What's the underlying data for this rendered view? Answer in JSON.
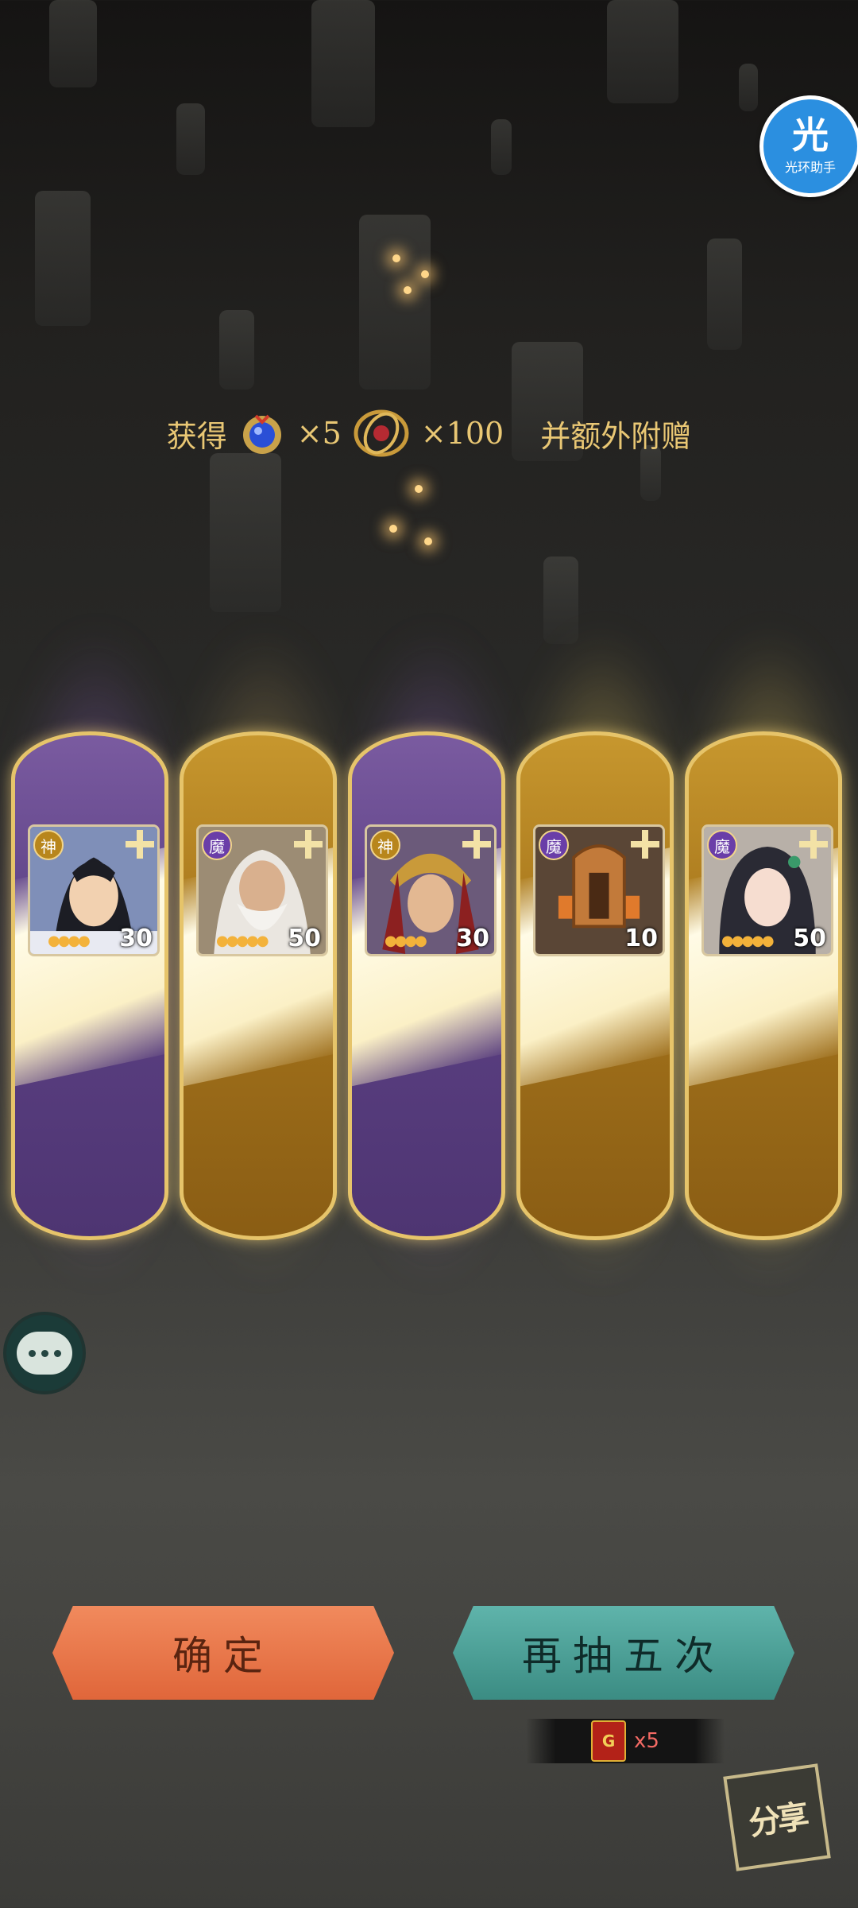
{
  "reward": {
    "prefix": "获得",
    "item1_count": "×5",
    "item2_count": "×100",
    "suffix": "并额外附赠",
    "item1_icon": "blue-gem-icon",
    "item2_icon": "red-orb-icon"
  },
  "assistant": {
    "glyph": "光",
    "label": "光环助手"
  },
  "cards": [
    {
      "badge": "神",
      "badge_type": "gold",
      "level": "30",
      "stars": 4,
      "frame": "purple"
    },
    {
      "badge": "魔",
      "badge_type": "purple",
      "level": "50",
      "stars": 5,
      "frame": "gold"
    },
    {
      "badge": "神",
      "badge_type": "gold",
      "level": "30",
      "stars": 4,
      "frame": "purple"
    },
    {
      "badge": "魔",
      "badge_type": "purple",
      "level": "10",
      "stars": 0,
      "frame": "gold"
    },
    {
      "badge": "魔",
      "badge_type": "purple",
      "level": "50",
      "stars": 5,
      "frame": "gold"
    }
  ],
  "buttons": {
    "confirm": "确定",
    "draw_again": "再抽五次"
  },
  "cost": {
    "count": "x5",
    "ticket_letter": "G"
  },
  "share": {
    "label": "分享"
  },
  "colors": {
    "gold": "#e9c774",
    "confirm": "#e0663a",
    "again": "#3b8c83"
  }
}
